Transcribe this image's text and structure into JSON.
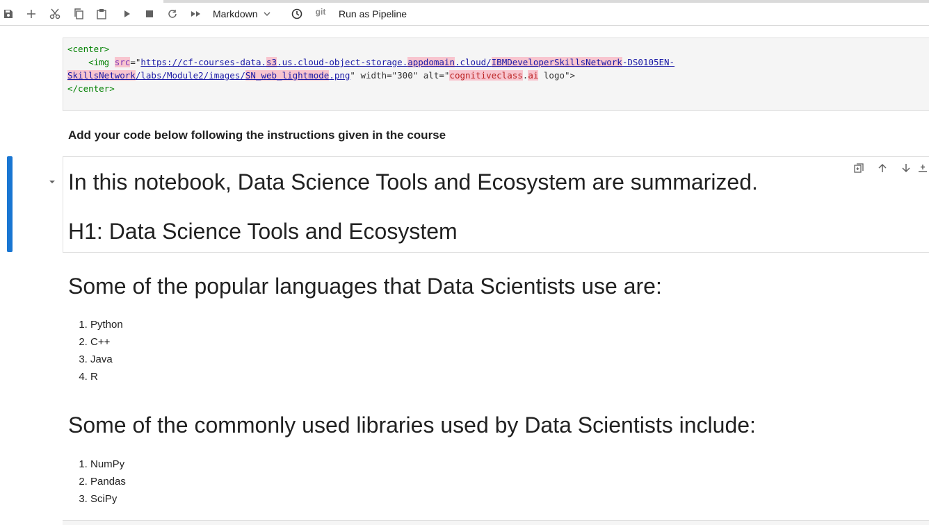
{
  "toolbar": {
    "cell_type": "Markdown",
    "git": "git",
    "run_pipeline": "Run as Pipeline"
  },
  "code_cell": {
    "line1_tag": "<center>",
    "line2_indent": "    ",
    "line2_open": "<img ",
    "line2_src_attr": "src",
    "line2_eq": "=\"",
    "url_part1": "https://cf-courses-data.",
    "url_s3": "s3",
    "url_part2": ".us.cloud-object-storage.",
    "url_appdomain": "appdomain",
    "url_part3": ".cloud/",
    "url_ibm": "IBMDeveloperSkillsNetwork",
    "url_part4": "-DS0105EN-",
    "url_line2_a": "SkillsNetwork",
    "url_line2_b": "/labs/Module2/images/",
    "url_line2_c": "SN_web_lightmode",
    "url_line2_d": ".png",
    "after_url": "\" width=\"300\" alt=\"",
    "alt_a": "cognitiveclass",
    "alt_dot": ".",
    "alt_b": "ai",
    "alt_c": " logo\">",
    "line4_tag": "</center>"
  },
  "instructions": "Add your code below following the instructions given in the course",
  "active_cell": {
    "heading1": "In this notebook, Data Science Tools and Ecosystem are summarized.",
    "heading2": "H1: Data Science Tools and Ecosystem"
  },
  "languages": {
    "heading": "Some of the popular languages that Data Scientists use are:",
    "items": [
      "Python",
      "C++",
      "Java",
      "R"
    ]
  },
  "libraries": {
    "heading": "Some of the commonly used libraries used by Data Scientists include:",
    "items": [
      "NumPy",
      "Pandas",
      "SciPy"
    ]
  },
  "icons": {
    "save": "save-icon",
    "add": "plus-icon",
    "cut": "scissors-icon",
    "copy": "copy-icon",
    "paste": "paste-icon",
    "run": "play-icon",
    "stop": "stop-icon",
    "restart": "refresh-icon",
    "run_all": "fast-forward-icon",
    "history": "clock-icon"
  },
  "colors": {
    "active_bar": "#1976d2",
    "code_bg": "#f5f5f5",
    "highlight": "#f8c5cf"
  }
}
